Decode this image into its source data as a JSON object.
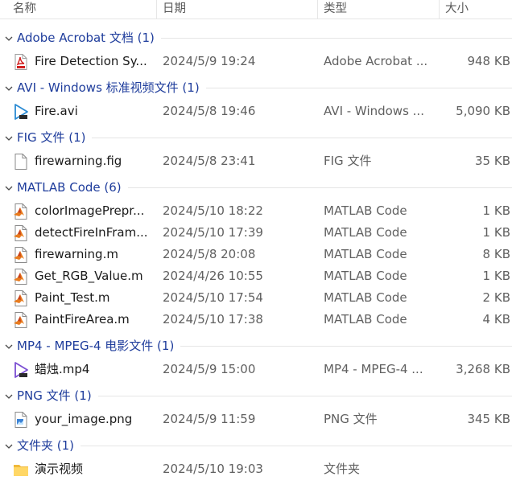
{
  "columns": {
    "name": "名称",
    "date": "日期",
    "type": "类型",
    "size": "大小"
  },
  "groups": [
    {
      "title": "Adobe Acrobat 文档 (1)",
      "files": [
        {
          "name": "Fire Detection Sy...",
          "date": "2024/5/9 19:24",
          "type": "Adobe Acrobat ...",
          "size": "948 KB",
          "icon": "pdf-icon"
        }
      ]
    },
    {
      "title": "AVI - Windows 标准视频文件 (1)",
      "files": [
        {
          "name": "Fire.avi",
          "date": "2024/5/8 19:46",
          "type": "AVI - Windows ...",
          "size": "5,090 KB",
          "icon": "video-icon"
        }
      ]
    },
    {
      "title": "FIG 文件 (1)",
      "files": [
        {
          "name": "firewarning.fig",
          "date": "2024/5/8 23:41",
          "type": "FIG 文件",
          "size": "35 KB",
          "icon": "blank-file-icon"
        }
      ]
    },
    {
      "title": "MATLAB Code (6)",
      "files": [
        {
          "name": "colorImagePrepr...",
          "date": "2024/5/10 18:22",
          "type": "MATLAB Code",
          "size": "1 KB",
          "icon": "matlab-file-icon"
        },
        {
          "name": "detectFireInFram...",
          "date": "2024/5/10 17:39",
          "type": "MATLAB Code",
          "size": "1 KB",
          "icon": "matlab-file-icon"
        },
        {
          "name": "firewarning.m",
          "date": "2024/5/8 20:08",
          "type": "MATLAB Code",
          "size": "8 KB",
          "icon": "matlab-file-icon"
        },
        {
          "name": "Get_RGB_Value.m",
          "date": "2024/4/26 10:55",
          "type": "MATLAB Code",
          "size": "1 KB",
          "icon": "matlab-file-icon"
        },
        {
          "name": "Paint_Test.m",
          "date": "2024/5/10 17:54",
          "type": "MATLAB Code",
          "size": "2 KB",
          "icon": "matlab-file-icon"
        },
        {
          "name": "PaintFireArea.m",
          "date": "2024/5/10 17:38",
          "type": "MATLAB Code",
          "size": "4 KB",
          "icon": "matlab-file-icon"
        }
      ]
    },
    {
      "title": "MP4 - MPEG-4 电影文件 (1)",
      "files": [
        {
          "name": "蜡烛.mp4",
          "date": "2024/5/9 15:00",
          "type": "MP4 - MPEG-4 ...",
          "size": "3,268 KB",
          "icon": "video-mp4-icon"
        }
      ]
    },
    {
      "title": "PNG 文件 (1)",
      "files": [
        {
          "name": "your_image.png",
          "date": "2024/5/9 11:59",
          "type": "PNG 文件",
          "size": "345 KB",
          "icon": "image-file-icon"
        }
      ]
    },
    {
      "title": "文件夹 (1)",
      "files": [
        {
          "name": "演示视频",
          "date": "2024/5/10 19:03",
          "type": "文件夹",
          "size": "",
          "icon": "folder-icon"
        }
      ]
    }
  ],
  "colors": {
    "group_title": "#1f3d9c",
    "secondary_text": "#606060"
  }
}
